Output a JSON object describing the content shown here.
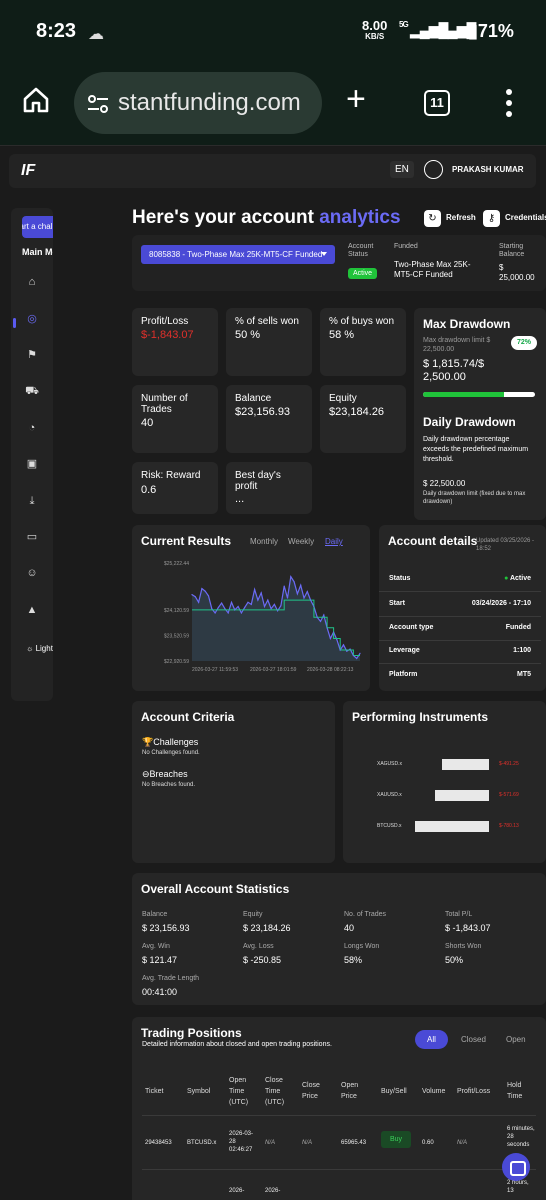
{
  "status_bar": {
    "time": "8:23",
    "net_speed": "8.00",
    "net_unit": "KB/S",
    "net_type": "5G",
    "battery": "71%"
  },
  "browser": {
    "url": "stantfunding.com",
    "tab_count": "11"
  },
  "topnav": {
    "language": "EN",
    "user_name": "PRAKASH KUMAR"
  },
  "sidebar": {
    "start_label": "Start a challenge",
    "section_label": "Main Menu",
    "light_label": "Light"
  },
  "header": {
    "title_prefix": "Here's your account ",
    "title_accent": "analytics",
    "refresh_label": "Refresh",
    "credentials_label": "Credentials"
  },
  "account_bar": {
    "selected_account": "8085838 - Two-Phase Max 25K-MT5-CF Funded",
    "status_label": "Account Status",
    "status_value": "Active",
    "funded_label": "Funded",
    "funded_value": "Two-Phase Max 25K-MT5-CF Funded",
    "starting_balance_label": "Starting Balance",
    "starting_balance_value": "$ 25,000.00"
  },
  "metrics": [
    {
      "label": "Profit/Loss",
      "value": "$-1,843.07"
    },
    {
      "label": "% of sells won",
      "value": "50 %"
    },
    {
      "label": "% of buys won",
      "value": "58 %"
    },
    {
      "label": "Number of Trades",
      "value": "40"
    },
    {
      "label": "Balance",
      "value": "$23,156.93"
    },
    {
      "label": "Equity",
      "value": "$23,184.26"
    },
    {
      "label": "Risk: Reward",
      "value": "0.6"
    },
    {
      "label": "Best day's profit",
      "value": "..."
    }
  ],
  "max_drawdown": {
    "title": "Max Drawdown",
    "limit_label": "Max drawdown limit $ 22,500.00",
    "percent_badge": "72%",
    "progress": 0.72,
    "value": "$ 1,815.74/$ 2,500.00"
  },
  "daily_drawdown": {
    "title": "Daily Drawdown",
    "description": "Daily drawdown percentage exceeds the predefined maximum threshold.",
    "value": "$ 22,500.00",
    "note": "Daily drawdown limit (fixed due to max drawdown)"
  },
  "current_results": {
    "title": "Current Results",
    "tabs": [
      "Monthly",
      "Weekly",
      "Daily"
    ],
    "active_tab": "Daily"
  },
  "chart_data": {
    "type": "area",
    "y_ticks": [
      "$25,222.44",
      "$24,120.59",
      "$23,520.59",
      "$22,920.59"
    ],
    "x_ticks": [
      "2026-03-27 11:59:53",
      "2026-03-27 18:01:59",
      "2026-03-28 08:22:13"
    ],
    "ylim": [
      22920.59,
      25222.44
    ],
    "series": [
      {
        "values": [
          24480,
          24430,
          24300,
          24620,
          24560,
          24450,
          24150,
          24050,
          24180,
          24280,
          24150,
          24050,
          24300,
          24120,
          24200,
          24050,
          24180,
          24300,
          24250,
          24600,
          24350,
          24520,
          24200,
          24350,
          24150,
          24250,
          24100,
          24220,
          24680,
          24400,
          24900,
          24780,
          24500,
          24700,
          24400,
          24550,
          24350,
          24200,
          23950,
          23850,
          24000,
          23700,
          23450,
          23600,
          23420,
          23180,
          23300,
          23150,
          23200,
          23050,
          22980,
          23100
        ]
      },
      {
        "values": [
          24120,
          24120,
          24120,
          24120,
          24120,
          24120,
          24120,
          24120,
          24120,
          24120,
          24120,
          24120,
          24120,
          24120,
          24120,
          24120,
          24120,
          24120,
          24120,
          24120,
          24120,
          24120,
          24120,
          24120,
          24120,
          24120,
          24120,
          24120,
          24350,
          24350,
          24350,
          24350,
          24350,
          24350,
          24350,
          24350,
          24350,
          23950,
          23950,
          23950,
          23950,
          23700,
          23700,
          23450,
          23450,
          23180,
          23180,
          23180,
          23180,
          23050,
          23050,
          23050
        ]
      }
    ]
  },
  "account_details": {
    "title": "Account details",
    "updated": "Updated 03/25/2026 - 18:52",
    "rows": [
      {
        "label": "Status",
        "value": "Active"
      },
      {
        "label": "Start",
        "value": "03/24/2026 - 17:10"
      },
      {
        "label": "Account type",
        "value": "Funded"
      },
      {
        "label": "Leverage",
        "value": "1:100"
      },
      {
        "label": "Platform",
        "value": "MT5"
      }
    ]
  },
  "account_criteria": {
    "title": "Account Criteria",
    "challenges_label": "Challenges",
    "challenges_note": "No Challenges found.",
    "breaches_label": "Breaches",
    "breaches_note": "No Breaches found."
  },
  "performing_instruments": {
    "title": "Performing Instruments",
    "items": [
      {
        "symbol": "XAGUSD.x",
        "value": "$-491.25",
        "amount": -491.25
      },
      {
        "symbol": "XAUUSD.x",
        "value": "$-571.69",
        "amount": -571.69
      },
      {
        "symbol": "BTCUSD.x",
        "value": "$-780.13",
        "amount": -780.13
      }
    ]
  },
  "overall_stats": {
    "title": "Overall Account Statistics",
    "items": [
      {
        "label": "Balance",
        "value": "$ 23,156.93"
      },
      {
        "label": "Equity",
        "value": "$ 23,184.26"
      },
      {
        "label": "No. of Trades",
        "value": "40"
      },
      {
        "label": "Total P/L",
        "value": "$ -1,843.07"
      },
      {
        "label": "Avg. Win",
        "value": "$ 121.47"
      },
      {
        "label": "Avg. Loss",
        "value": "$ -250.85"
      },
      {
        "label": "Longs Won",
        "value": "58%"
      },
      {
        "label": "Shorts Won",
        "value": "50%"
      },
      {
        "label": "Avg. Trade Length",
        "value": "00:41:00"
      }
    ]
  },
  "trading_positions": {
    "title": "Trading Positions",
    "subtitle": "Detailed information about closed and open trading positions.",
    "filters": [
      "All",
      "Closed",
      "Open"
    ],
    "active_filter": "All",
    "columns": [
      "Ticket",
      "Symbol",
      "Open Time (UTC)",
      "Close Time (UTC)",
      "Close Price",
      "Open Price",
      "Buy/Sell",
      "Volume",
      "Profit/Loss",
      "Hold Time"
    ],
    "rows": [
      {
        "ticket": "29438453",
        "symbol": "BTCUSD.x",
        "open_time": "2026-03-28 02:46:27",
        "close_time": "N/A",
        "close_price": "N/A",
        "open_price": "65965.43",
        "side": "Buy",
        "volume": "0.60",
        "pl": "N/A",
        "hold": "6 minutes, 28 seconds"
      },
      {
        "ticket": "",
        "symbol": "",
        "open_time": "2026-",
        "close_time": "2026-",
        "close_price": "",
        "open_price": "",
        "side": "",
        "volume": "",
        "pl": "",
        "hold": "2 hours, 13"
      }
    ]
  }
}
